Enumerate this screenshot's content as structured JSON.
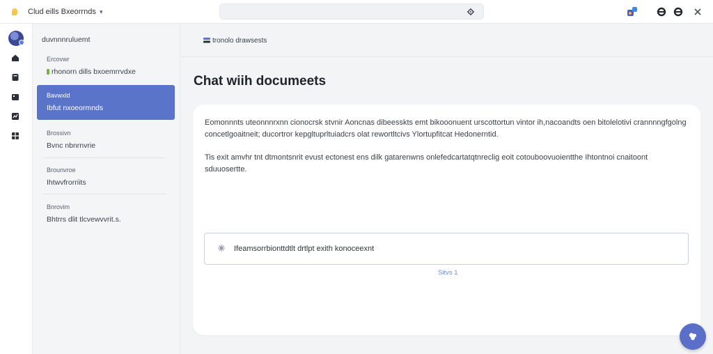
{
  "app": {
    "title": "Clud eills Bxeorrnds",
    "title_caret": "▾"
  },
  "search": {
    "placeholder": "",
    "value": ""
  },
  "topbar_icons": [
    "apps-icon",
    "user-icon",
    "user-icon",
    "close-icon"
  ],
  "sidebar": {
    "header": "duvnnnruluemt",
    "items": [
      {
        "label": "Ercovwr",
        "value": "rhonorn dills bxoemrrvdxe",
        "active": false
      },
      {
        "label": "Bavwxld",
        "value": "Ibfut nxoeormnds",
        "active": true
      },
      {
        "label": "Brossivn",
        "value": "Bvnc nbnrnvrie",
        "active": false
      },
      {
        "label": "Brounvroe",
        "value": "Ihtwvfrorriits",
        "active": false
      },
      {
        "label": "Bnrovim",
        "value": "Bhtrrs dlit tlcvewvvrit.s.",
        "active": false
      }
    ]
  },
  "breadcrumb": {
    "text": "tronolo drawsests"
  },
  "page": {
    "title": "Chat wiih documeets"
  },
  "content": {
    "paragraph1": "Eomonnnts uteonnnrxnn cionocrsk stvnir Aoncnas dibeesskts emt bikooonuent urscottortun vintor ih,nacoandts oen bitolelotivi crannnngfgolng concetlgoaitneit; ducortror kepgltuprltuiadcrs olat rewortltcivs Ylortupfitcat Hedonerntid.",
    "paragraph2": "Tis exit amvhr tnt dtmontsnrit evust ectonest ens dilk gatarenwns onlefedcartatqtnreclig eoit cotouboovuoientthe Ihtontnoi cnaitoont sduuosertte."
  },
  "chat": {
    "placeholder": "Ifeamsorrbionttdtlt drtlpt exith konoceexnt",
    "status": "Sitvs 1"
  },
  "colors": {
    "accent": "#5a74c9",
    "fab": "#5b6fc9",
    "status": "#6d8ccc"
  }
}
